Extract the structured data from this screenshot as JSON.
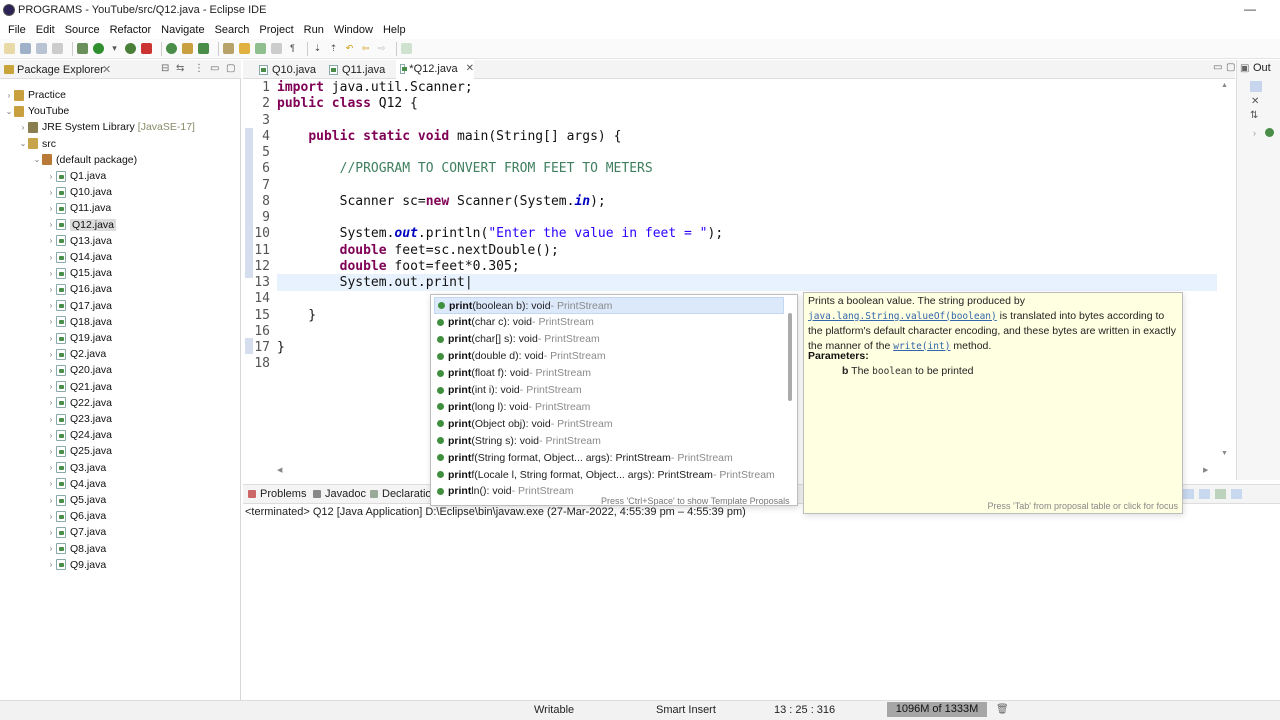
{
  "window": {
    "title": "PROGRAMS - YouTube/src/Q12.java - Eclipse IDE"
  },
  "menu": [
    "File",
    "Edit",
    "Source",
    "Refactor",
    "Navigate",
    "Search",
    "Project",
    "Run",
    "Window",
    "Help"
  ],
  "package_explorer": {
    "title": "Package Explorer",
    "tree": [
      {
        "label": "Practice",
        "level": 0,
        "kind": "proj",
        "twisty": "›"
      },
      {
        "label": "YouTube",
        "level": 0,
        "kind": "proj",
        "twisty": "⌄"
      },
      {
        "label": "JRE System Library",
        "extra": "[JavaSE-17]",
        "level": 1,
        "kind": "lib",
        "twisty": "›"
      },
      {
        "label": "src",
        "level": 1,
        "kind": "src",
        "twisty": "⌄"
      },
      {
        "label": "(default package)",
        "level": 2,
        "kind": "pkgi",
        "twisty": "⌄"
      },
      {
        "label": "Q1.java",
        "level": 3,
        "kind": "java",
        "twisty": "›"
      },
      {
        "label": "Q10.java",
        "level": 3,
        "kind": "java",
        "twisty": "›"
      },
      {
        "label": "Q11.java",
        "level": 3,
        "kind": "java",
        "twisty": "›"
      },
      {
        "label": "Q12.java",
        "level": 3,
        "kind": "java",
        "twisty": "›",
        "selected": true
      },
      {
        "label": "Q13.java",
        "level": 3,
        "kind": "java",
        "twisty": "›"
      },
      {
        "label": "Q14.java",
        "level": 3,
        "kind": "java",
        "twisty": "›"
      },
      {
        "label": "Q15.java",
        "level": 3,
        "kind": "java",
        "twisty": "›"
      },
      {
        "label": "Q16.java",
        "level": 3,
        "kind": "java",
        "twisty": "›"
      },
      {
        "label": "Q17.java",
        "level": 3,
        "kind": "java",
        "twisty": "›"
      },
      {
        "label": "Q18.java",
        "level": 3,
        "kind": "java",
        "twisty": "›"
      },
      {
        "label": "Q19.java",
        "level": 3,
        "kind": "java",
        "twisty": "›"
      },
      {
        "label": "Q2.java",
        "level": 3,
        "kind": "java",
        "twisty": "›"
      },
      {
        "label": "Q20.java",
        "level": 3,
        "kind": "java",
        "twisty": "›"
      },
      {
        "label": "Q21.java",
        "level": 3,
        "kind": "java",
        "twisty": "›"
      },
      {
        "label": "Q22.java",
        "level": 3,
        "kind": "java",
        "twisty": "›"
      },
      {
        "label": "Q23.java",
        "level": 3,
        "kind": "java",
        "twisty": "›"
      },
      {
        "label": "Q24.java",
        "level": 3,
        "kind": "java",
        "twisty": "›"
      },
      {
        "label": "Q25.java",
        "level": 3,
        "kind": "java",
        "twisty": "›"
      },
      {
        "label": "Q3.java",
        "level": 3,
        "kind": "java",
        "twisty": "›"
      },
      {
        "label": "Q4.java",
        "level": 3,
        "kind": "java",
        "twisty": "›"
      },
      {
        "label": "Q5.java",
        "level": 3,
        "kind": "java",
        "twisty": "›"
      },
      {
        "label": "Q6.java",
        "level": 3,
        "kind": "java",
        "twisty": "›"
      },
      {
        "label": "Q7.java",
        "level": 3,
        "kind": "java",
        "twisty": "›"
      },
      {
        "label": "Q8.java",
        "level": 3,
        "kind": "java",
        "twisty": "›"
      },
      {
        "label": "Q9.java",
        "level": 3,
        "kind": "java",
        "twisty": "›"
      }
    ]
  },
  "editor": {
    "tabs": [
      {
        "label": "Q10.java"
      },
      {
        "label": "Q11.java"
      },
      {
        "label": "*Q12.java",
        "active": true
      }
    ],
    "lines": [
      {
        "n": "1",
        "html": "<span class=\"kw\">import</span> java.util.Scanner;"
      },
      {
        "n": "2",
        "html": "<span class=\"kw\">public class</span> Q12 {"
      },
      {
        "n": "3",
        "html": ""
      },
      {
        "n": "4",
        "html": "    <span class=\"kw\">public static void</span> main(String[] args) {"
      },
      {
        "n": "5",
        "html": ""
      },
      {
        "n": "6",
        "html": "        <span class=\"cm\">//PROGRAM TO CONVERT FROM FEET TO METERS</span>"
      },
      {
        "n": "7",
        "html": ""
      },
      {
        "n": "8",
        "html": "        Scanner sc=<span class=\"kw\">new</span> Scanner(System.<span class=\"fld\">in</span>);"
      },
      {
        "n": "9",
        "html": ""
      },
      {
        "n": "10",
        "html": "        System.<span class=\"fld\">out</span>.println(<span class=\"str\">\"Enter the value in feet = \"</span>);"
      },
      {
        "n": "11",
        "html": "        <span class=\"kw\">double</span> feet=sc.nextDouble();"
      },
      {
        "n": "12",
        "html": "        <span class=\"kw\">double</span> foot=feet*0.305;"
      },
      {
        "n": "13",
        "html": "        System.out.print|"
      },
      {
        "n": "14",
        "html": ""
      },
      {
        "n": "15",
        "html": "    }"
      },
      {
        "n": "16",
        "html": ""
      },
      {
        "n": "17",
        "html": "}"
      },
      {
        "n": "18",
        "html": ""
      }
    ]
  },
  "content_assist": {
    "proposals": [
      {
        "name": "print",
        "args": "(boolean b)",
        "ret": " : void",
        "cls": " - PrintStream",
        "selected": true
      },
      {
        "name": "print",
        "args": "(char c)",
        "ret": " : void",
        "cls": " - PrintStream"
      },
      {
        "name": "print",
        "args": "(char[] s)",
        "ret": " : void",
        "cls": " - PrintStream"
      },
      {
        "name": "print",
        "args": "(double d)",
        "ret": " : void",
        "cls": " - PrintStream"
      },
      {
        "name": "print",
        "args": "(float f)",
        "ret": " : void",
        "cls": " - PrintStream"
      },
      {
        "name": "print",
        "args": "(int i)",
        "ret": " : void",
        "cls": " - PrintStream"
      },
      {
        "name": "print",
        "args": "(long l)",
        "ret": " : void",
        "cls": " - PrintStream"
      },
      {
        "name": "print",
        "args": "(Object obj)",
        "ret": " : void",
        "cls": " - PrintStream"
      },
      {
        "name": "print",
        "args": "(String s)",
        "ret": " : void",
        "cls": " - PrintStream"
      },
      {
        "name": "print",
        "suffix": "f",
        "args": "(String format, Object... args)",
        "ret": " : PrintStream",
        "cls": " - PrintStream"
      },
      {
        "name": "print",
        "suffix": "f",
        "args": "(Locale l, String format, Object... args)",
        "ret": " : PrintStream",
        "cls": " - PrintStream"
      },
      {
        "name": "print",
        "suffix": "ln",
        "args": "()",
        "ret": " : void",
        "cls": " - PrintStream"
      }
    ],
    "footer": "Press 'Ctrl+Space' to show Template Proposals"
  },
  "javadoc": {
    "text1": "Prints a boolean value. The string produced by",
    "code1": "java.lang.String.valueOf(boolean)",
    "text2": "is translated into bytes according to the platform's default character encoding, and these bytes are written in exactly the manner of the",
    "code2": "write(int)",
    "text3": "method.",
    "params_label": "Parameters:",
    "param_name": "b",
    "param_text_pre": "The",
    "param_code": "boolean",
    "param_text_post": "to be printed",
    "footer": "Press 'Tab' from proposal table or click for focus"
  },
  "bottom": {
    "tabs": [
      "Problems",
      "Javadoc",
      "Declaratio"
    ],
    "console": "<terminated> Q12 [Java Application] D:\\Eclipse\\bin\\javaw.exe  (27-Mar-2022, 4:55:39 pm – 4:55:39 pm)"
  },
  "status": {
    "writable": "Writable",
    "insert": "Smart Insert",
    "position": "13 : 25 : 316",
    "heap": "1096M of 1333M"
  },
  "right_strip": {
    "outline_label": "Out"
  }
}
